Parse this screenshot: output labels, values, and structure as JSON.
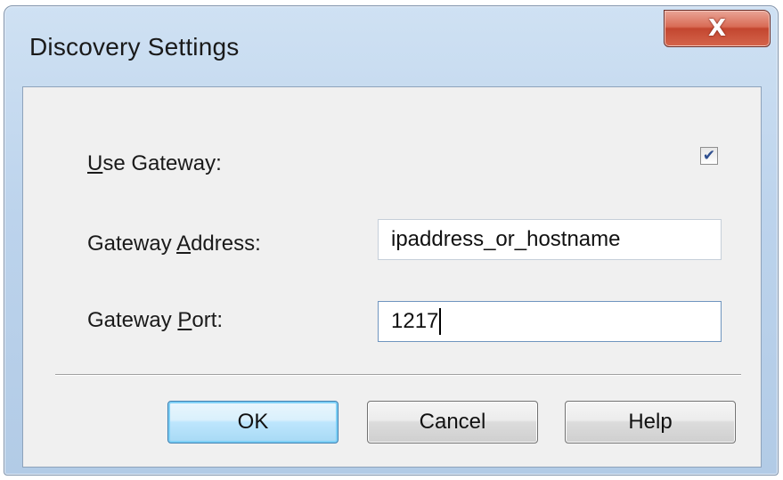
{
  "window": {
    "title": "Discovery Settings",
    "close_glyph": "X"
  },
  "form": {
    "use_gateway": {
      "label_mnemonic": "U",
      "label_rest": "se Gateway:",
      "checked": true,
      "check_glyph": "✔"
    },
    "gateway_address": {
      "label_before": "Gateway ",
      "label_mnemonic": "A",
      "label_after": "ddress:",
      "value": "ipaddress_or_hostname"
    },
    "gateway_port": {
      "label_before": "Gateway ",
      "label_mnemonic": "P",
      "label_after": "ort:",
      "value": "1217"
    }
  },
  "buttons": {
    "ok": "OK",
    "cancel": "Cancel",
    "help": "Help"
  },
  "colors": {
    "close_button": "#c3462f",
    "default_button_border": "#3c7fb1",
    "checkmark": "#2f4f8f"
  }
}
